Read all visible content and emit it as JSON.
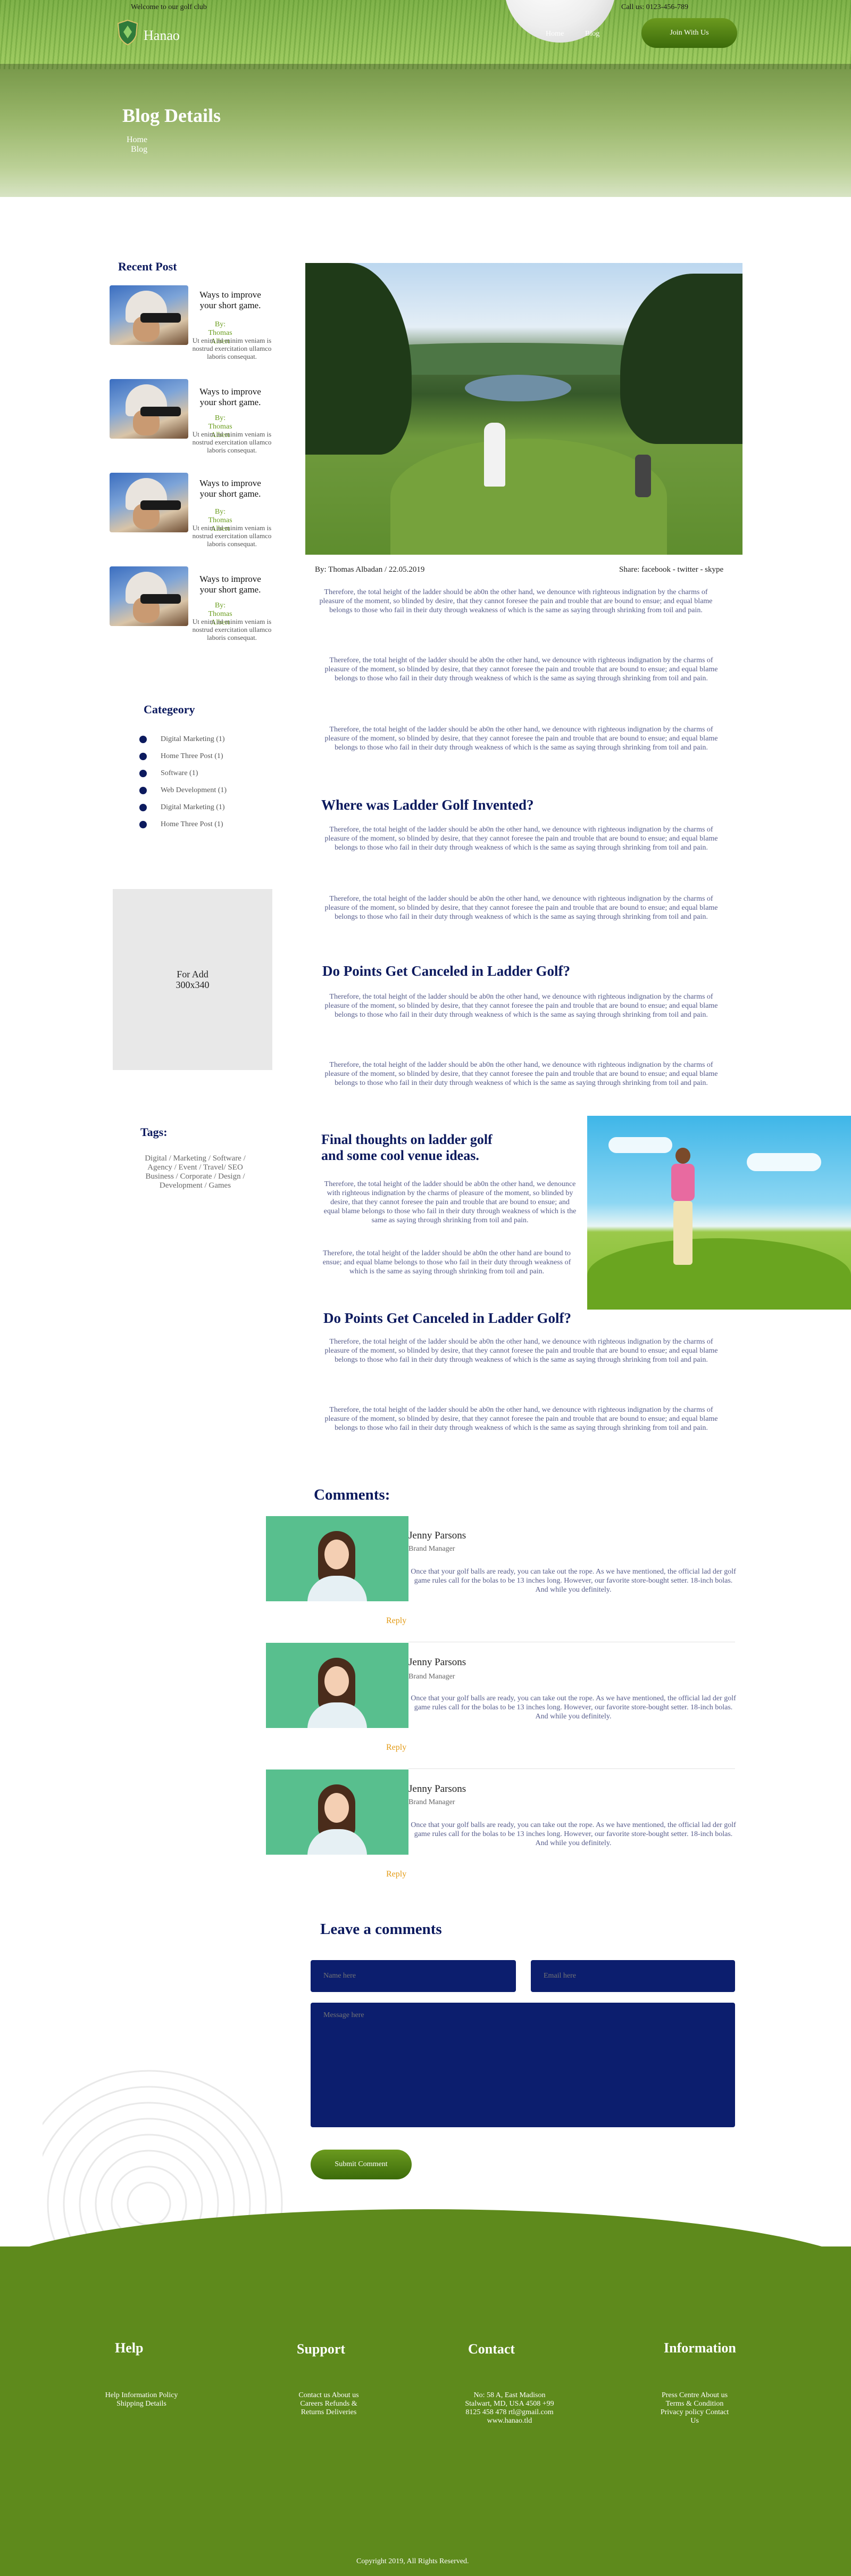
{
  "header": {
    "welcome": "Welcome to our golf club",
    "call_us": "Call us: 0123-456-789",
    "logo_text": "Hanao",
    "nav": {
      "home": "Home",
      "blog": "Blog"
    },
    "join_label": "Join With Us",
    "page_title": "Blog Details",
    "breadcrumb": {
      "home": "Home",
      "blog": "Blog"
    }
  },
  "sidebar": {
    "recent_title": "Recent Post",
    "recent_posts": [
      {
        "title": "Ways to improve your short game.",
        "by": "By: Thomas Albert",
        "excerpt": "Ut enim ad minim veniam is nostrud exercitation ullamco laboris consequat."
      },
      {
        "title": "Ways to improve your short game.",
        "by": "By: Thomas Albert",
        "excerpt": "Ut enim ad minim veniam is nostrud exercitation ullamco laboris consequat."
      },
      {
        "title": "Ways to improve your short game.",
        "by": "By: Thomas Albert",
        "excerpt": "Ut enim ad minim veniam is nostrud exercitation ullamco laboris consequat."
      },
      {
        "title": "Ways to improve your short game.",
        "by": "By: Thomas Albert",
        "excerpt": "Ut enim ad minim veniam is nostrud exercitation ullamco laboris consequat."
      }
    ],
    "category_title": "Categeory",
    "categories": [
      "Digital Marketing (1)",
      "Home Three Post (1)",
      "Software (1)",
      "Web Development (1)",
      "Digital Marketing (1)",
      "Home Three Post (1)"
    ],
    "ad_line1": "For Add",
    "ad_line2": "300x340",
    "tags_title": "Tags:",
    "tags": "Digital / Marketing / Software / Agency / Event / Travel/ SEO Business / Corporate / Design / Development / Games"
  },
  "article": {
    "byline": "By: Thomas Albadan / 22.05.2019",
    "share": "Share: facebook - twitter - skype",
    "paragraph": "Therefore, the total height of the ladder should be ab0n the other hand, we denounce with righteous indignation by the charms of pleasure of the moment, so blinded by desire, that they cannot foresee the pain and trouble that are bound to ensue; and equal blame belongs to those who fail in their duty through weakness of which is the same as saying through shrinking from toil and pain.",
    "para_short": "Therefore, the total height of the ladder should be ab0n the other hand are bound to ensue; and equal blame belongs to those who fail in their duty through weakness of which is the same as saying through shrinking from toil and pain.",
    "h_where": "Where was Ladder Golf Invented?",
    "h_points": "Do Points Get Canceled in Ladder Golf?",
    "h_final": "Final thoughts on ladder golf and some cool venue ideas.",
    "h_points2": "Do Points Get Canceled in Ladder Golf?"
  },
  "comments": {
    "title": "Comments:",
    "items": [
      {
        "name": "Jenny Parsons",
        "role": "Brand Manager",
        "text": "Once that your golf balls are ready, you can take out the rope. As we have mentioned, the official lad der golf game rules call for the bolas to be 13 inches long. However, our favorite store-bought setter. 18-inch bolas. And while you definitely.",
        "reply": "Reply"
      },
      {
        "name": "Jenny Parsons",
        "role": "Brand Manager",
        "text": "Once that your golf balls are ready, you can take out the rope. As we have mentioned, the official lad der golf game rules call for the bolas to be 13 inches long. However, our favorite store-bought setter. 18-inch bolas. And while you definitely.",
        "reply": "Reply"
      },
      {
        "name": "Jenny Parsons",
        "role": "Brand Manager",
        "text": "Once that your golf balls are ready, you can take out the rope. As we have mentioned, the official lad der golf game rules call for the bolas to be 13 inches long. However, our favorite store-bought setter. 18-inch bolas. And while you definitely.",
        "reply": "Reply"
      }
    ]
  },
  "form": {
    "title": "Leave a comments",
    "name_placeholder": "Name here",
    "email_placeholder": "Email here",
    "message_placeholder": "Message here",
    "submit_label": "Submit Comment"
  },
  "footer": {
    "help_title": "Help",
    "help_links": "Help Information Policy Shipping Details",
    "support_title": "Support",
    "support_links": "Contact us About us Careers Refunds & Returns Deliveries",
    "contact_title": "Contact",
    "contact_text": "No: 58 A, East Madison Stalwart, MD, USA 4508 +99 8125 458 478 rtl@gmail.com www.hanao.tld",
    "info_title": "Information",
    "info_links": "Press Centre About us Terms & Condition Privacy policy Contact Us",
    "copyright": "Copyright 2019, All Rights Reserved."
  },
  "colors": {
    "brand_green": "#5e8a1c",
    "navy": "#0c1a5e",
    "accent_orange": "#e39b16",
    "field_blue": "#0c1e6e"
  }
}
